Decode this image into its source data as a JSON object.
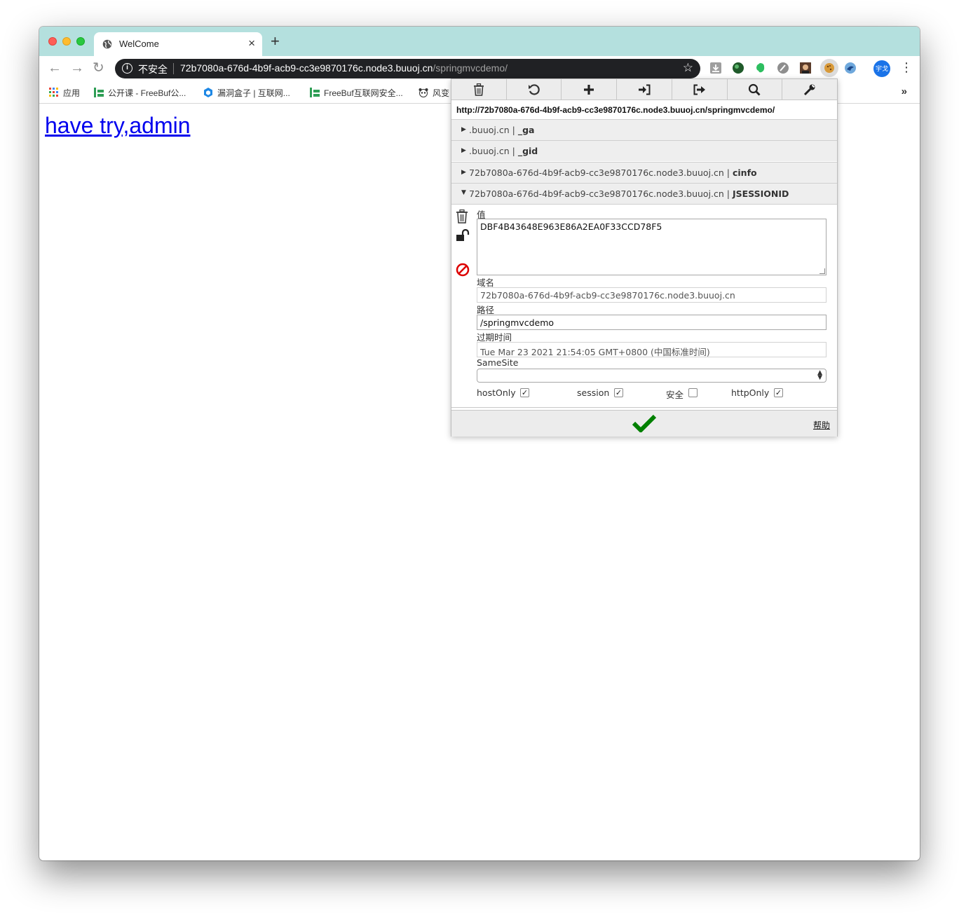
{
  "tab": {
    "title": "WelCome",
    "close": "×"
  },
  "toolbar": {
    "insecure_label": "不安全",
    "url_host": "72b7080a-676d-4b9f-acb9-cc3e9870176c.node3.buuoj.cn",
    "url_path": "/springmvcdemo/",
    "profile_label": "宇戈"
  },
  "bookmarks": [
    {
      "label": "应用",
      "icon": "apps-grid-icon"
    },
    {
      "label": "公开课 - FreeBuf公...",
      "icon": "freebuf-icon"
    },
    {
      "label": "漏洞盒子 | 互联网...",
      "icon": "vulbox-icon"
    },
    {
      "label": "FreeBuf互联网安全...",
      "icon": "freebuf-icon"
    },
    {
      "label": "风变",
      "icon": "panda-icon"
    }
  ],
  "page": {
    "link_text": "have try,admin",
    "link_color": "#0000ee"
  },
  "cookie_editor": {
    "tools": [
      "trash-icon",
      "refresh-icon",
      "plus-icon",
      "import-icon",
      "export-icon",
      "search-icon",
      "wrench-icon"
    ],
    "url": "http://72b7080a-676d-4b9f-acb9-cc3e9870176c.node3.buuoj.cn/springmvcdemo/",
    "cookies": [
      {
        "domain": ".buuoj.cn | ",
        "name": "_ga",
        "expanded": false
      },
      {
        "domain": ".buuoj.cn | ",
        "name": "_gid",
        "expanded": false
      },
      {
        "domain": "72b7080a-676d-4b9f-acb9-cc3e9870176c.node3.buuoj.cn | ",
        "name": "cinfo",
        "expanded": false
      },
      {
        "domain": "72b7080a-676d-4b9f-acb9-cc3e9870176c.node3.buuoj.cn | ",
        "name": "JSESSIONID",
        "expanded": true
      }
    ],
    "detail": {
      "value_label": "值",
      "value": "DBF4B43648E963E86A2EA0F33CCD78F5",
      "domain_label": "域名",
      "domain": "72b7080a-676d-4b9f-acb9-cc3e9870176c.node3.buuoj.cn",
      "path_label": "路径",
      "path": "/springmvcdemo",
      "expiry_label": "过期时间",
      "expiry": "Tue Mar 23 2021 21:54:05 GMT+0800 (中国标准时间)",
      "samesite_label": "SameSite",
      "samesite_value": "",
      "hostonly_label": "hostOnly",
      "hostonly_checked": true,
      "session_label": "session",
      "session_checked": true,
      "secure_label": "安全",
      "secure_checked": false,
      "httponly_label": "httpOnly",
      "httponly_checked": true
    },
    "help_label": "帮助",
    "accent_color": "#008000",
    "block_color": "#dd0000"
  }
}
